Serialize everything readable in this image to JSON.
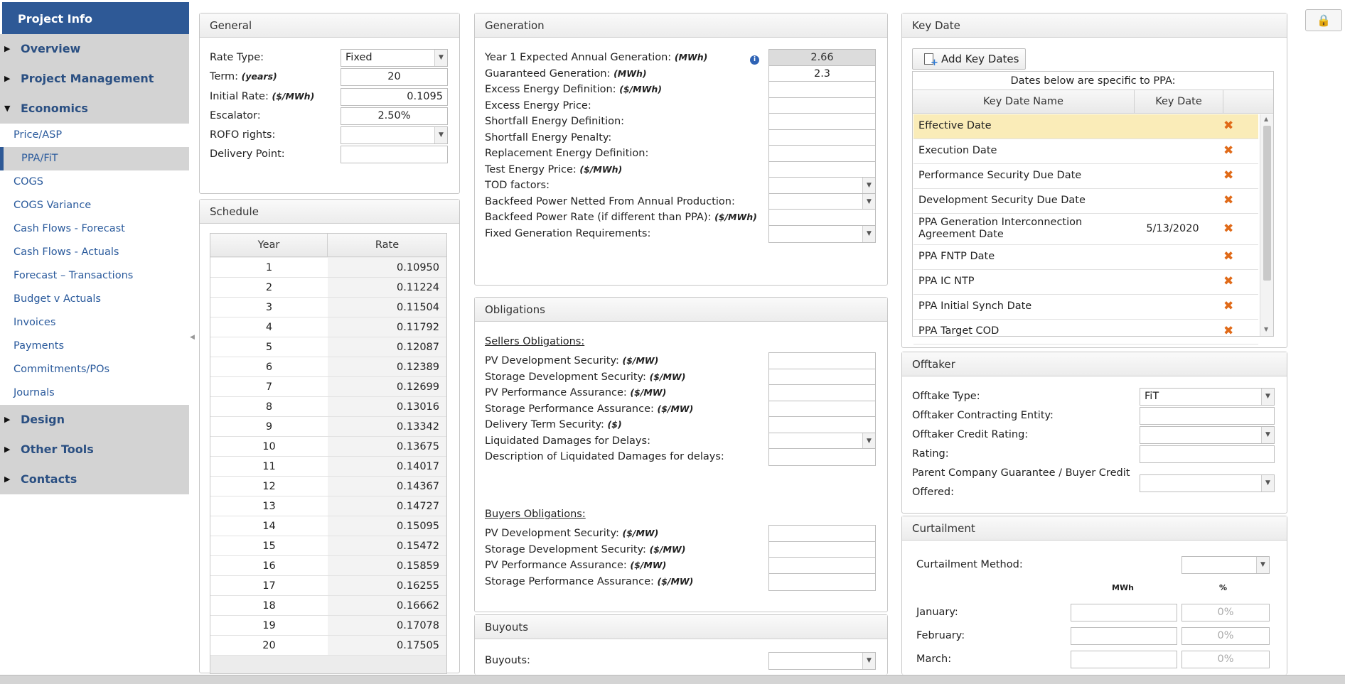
{
  "sidebar": {
    "header": "Project Info",
    "groups": [
      "Overview",
      "Project Management",
      "Economics",
      "Design",
      "Other Tools",
      "Contacts"
    ],
    "items": [
      "Price/ASP",
      "PPA/FiT",
      "COGS",
      "COGS Variance",
      "Cash Flows - Forecast",
      "Cash Flows - Actuals",
      "Forecast – Transactions",
      "Budget v Actuals",
      "Invoices",
      "Payments",
      "Commitments/POs",
      "Journals"
    ]
  },
  "general": {
    "title": "General",
    "rate_type_label": "Rate Type:",
    "rate_type": "Fixed",
    "term_label": "Term:",
    "term_unit": "(years)",
    "term": "20",
    "initial_rate_label": "Initial Rate:",
    "initial_rate_unit": "($/MWh)",
    "initial_rate": "0.1095",
    "escalator_label": "Escalator:",
    "escalator": "2.50%",
    "rofo_label": "ROFO rights:",
    "rofo": "",
    "delivery_label": "Delivery Point:",
    "delivery": ""
  },
  "schedule": {
    "title": "Schedule",
    "col_year": "Year",
    "col_rate": "Rate",
    "rows": [
      [
        "1",
        "0.10950"
      ],
      [
        "2",
        "0.11224"
      ],
      [
        "3",
        "0.11504"
      ],
      [
        "4",
        "0.11792"
      ],
      [
        "5",
        "0.12087"
      ],
      [
        "6",
        "0.12389"
      ],
      [
        "7",
        "0.12699"
      ],
      [
        "8",
        "0.13016"
      ],
      [
        "9",
        "0.13342"
      ],
      [
        "10",
        "0.13675"
      ],
      [
        "11",
        "0.14017"
      ],
      [
        "12",
        "0.14367"
      ],
      [
        "13",
        "0.14727"
      ],
      [
        "14",
        "0.15095"
      ],
      [
        "15",
        "0.15472"
      ],
      [
        "16",
        "0.15859"
      ],
      [
        "17",
        "0.16255"
      ],
      [
        "18",
        "0.16662"
      ],
      [
        "19",
        "0.17078"
      ],
      [
        "20",
        "0.17505"
      ]
    ]
  },
  "generation": {
    "title": "Generation",
    "fields": [
      {
        "label": "Year 1 Expected Annual Generation:",
        "unit": "(MWh)",
        "value": "2.66"
      },
      {
        "label": "Guaranteed Generation:",
        "unit": "(MWh)",
        "value": "2.3"
      },
      {
        "label": "Excess Energy Definition:",
        "unit": "($/MWh)",
        "value": ""
      },
      {
        "label": "Excess Energy Price:",
        "unit": "",
        "value": ""
      },
      {
        "label": "Shortfall Energy Definition:",
        "unit": "",
        "value": ""
      },
      {
        "label": "Shortfall Energy Penalty:",
        "unit": "",
        "value": ""
      },
      {
        "label": "Replacement Energy Definition:",
        "unit": "",
        "value": ""
      },
      {
        "label": "Test Energy Price:",
        "unit": "($/MWh)",
        "value": ""
      },
      {
        "label": "TOD factors:",
        "unit": "",
        "value": ""
      },
      {
        "label": "Backfeed Power Netted From Annual Production:",
        "unit": "",
        "value": ""
      },
      {
        "label": "Backfeed Power Rate (if different than PPA):",
        "unit": "($/MWh)",
        "value": ""
      },
      {
        "label": "Fixed Generation Requirements:",
        "unit": "",
        "value": ""
      }
    ]
  },
  "obligations": {
    "title": "Obligations",
    "sellers_heading": "Sellers Obligations:",
    "sellers": [
      {
        "label": "PV Development Security:",
        "unit": "($/MW)"
      },
      {
        "label": "Storage Development Security:",
        "unit": "($/MW)"
      },
      {
        "label": "PV Performance Assurance:",
        "unit": "($/MW)"
      },
      {
        "label": "Storage Performance Assurance:",
        "unit": "($/MW)"
      },
      {
        "label": "Delivery Term Security:",
        "unit": "($)"
      },
      {
        "label": "Liquidated Damages for Delays:",
        "unit": ""
      },
      {
        "label": "Description of Liquidated Damages for delays:",
        "unit": ""
      }
    ],
    "buyers_heading": "Buyers Obligations:",
    "buyers": [
      {
        "label": "PV Development Security:",
        "unit": "($/MW)"
      },
      {
        "label": "Storage Development Security:",
        "unit": "($/MW)"
      },
      {
        "label": "PV Performance Assurance:",
        "unit": "($/MW)"
      },
      {
        "label": "Storage Performance Assurance:",
        "unit": "($/MW)"
      }
    ]
  },
  "buyouts": {
    "title": "Buyouts",
    "label": "Buyouts:",
    "value": ""
  },
  "key_date": {
    "title": "Key Date",
    "add_button": "Add Key Dates",
    "banner": "Dates below are specific to PPA:",
    "col_name": "Key Date Name",
    "col_date": "Key Date",
    "rows": [
      {
        "name": "Effective Date",
        "date": ""
      },
      {
        "name": "Execution Date",
        "date": ""
      },
      {
        "name": "Performance Security Due Date",
        "date": ""
      },
      {
        "name": "Development Security Due Date",
        "date": ""
      },
      {
        "name": "PPA Generation Interconnection Agreement Date",
        "date": "5/13/2020"
      },
      {
        "name": "PPA FNTP Date",
        "date": ""
      },
      {
        "name": "PPA IC NTP",
        "date": ""
      },
      {
        "name": "PPA Initial Synch Date",
        "date": ""
      },
      {
        "name": "PPA Target COD",
        "date": ""
      }
    ],
    "delete_glyph": "✖"
  },
  "offtaker": {
    "title": "Offtaker",
    "type_label": "Offtake Type:",
    "type": "FiT",
    "entity_label": "Offtaker Contracting Entity:",
    "credit_label": "Offtaker Credit Rating:",
    "rating_label": "Rating:",
    "guarantee_label_1": "Parent Company Guarantee / Buyer Credit",
    "guarantee_label_2": "Offered:"
  },
  "curtailment": {
    "title": "Curtailment",
    "method_label": "Curtailment Method:",
    "col_mwh": "MWh",
    "col_pct": "%",
    "months": [
      {
        "label": "January:",
        "pct": "0%"
      },
      {
        "label": "February:",
        "pct": "0%"
      },
      {
        "label": "March:",
        "pct": "0%"
      }
    ]
  },
  "colors": {
    "sidebar_header": "#2e5996",
    "nav_link": "#2a5a9c",
    "highlight_row": "#faecb8",
    "delete": "#e06a18"
  }
}
